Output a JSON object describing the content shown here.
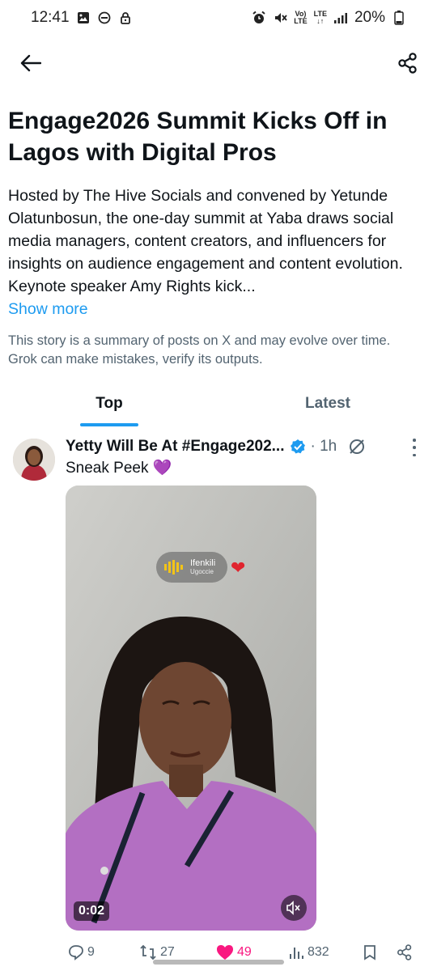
{
  "status_bar": {
    "time": "12:41",
    "battery": "20%",
    "network_top": "Vo)",
    "network_bottom": "LTE",
    "lte_top": "LTE",
    "lte_bottom": "↓↑"
  },
  "story": {
    "title": "Engage2026 Summit Kicks Off in Lagos with Digital Pros",
    "summary": "Hosted by The Hive Socials and convened by Yetunde Olatunbosun, the one-day summit at Yaba draws social media managers, content creators, and influencers for insights on audience engagement and content evolution. Keynote speaker Amy Rights kick...",
    "show_more": "Show more",
    "disclaimer": "This story is a summary of posts on X and may evolve over time. Grok can make mistakes, verify its outputs."
  },
  "tabs": [
    {
      "label": "Top",
      "active": true
    },
    {
      "label": "Latest",
      "active": false
    }
  ],
  "post": {
    "author": "Yetty Will Be At #Engage202...",
    "time": "· 1h",
    "text": "Sneak Peek 💜",
    "media": {
      "music_title": "Ifenkili",
      "music_artist": "Ugoccie",
      "duration": "0:02"
    },
    "stats": {
      "replies": "9",
      "reposts": "27",
      "likes": "49",
      "views": "832"
    }
  },
  "colors": {
    "accent": "#1d9bf0",
    "like": "#f91880",
    "muted_text": "#536471"
  }
}
